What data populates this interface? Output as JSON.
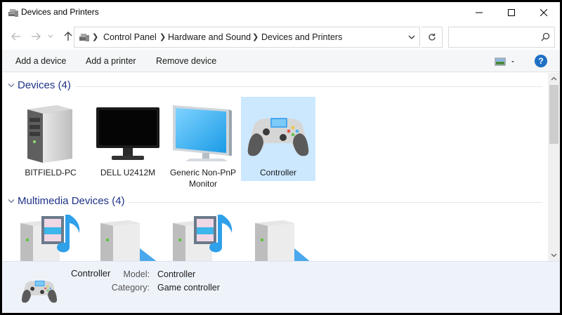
{
  "window": {
    "title": "Devices and Printers",
    "minimize_glyph": "—",
    "maximize_glyph": "☐",
    "close_glyph": "✕"
  },
  "address": {
    "crumbs": [
      "Control Panel",
      "Hardware and Sound",
      "Devices and Printers"
    ],
    "search_placeholder": ""
  },
  "toolbar": {
    "add_device": "Add a device",
    "add_printer": "Add a printer",
    "remove_device": "Remove device",
    "help": "?"
  },
  "groups": [
    {
      "title": "Devices (4)",
      "items": [
        {
          "label": "BITFIELD-PC",
          "icon": "desktop-computer-icon",
          "selected": false
        },
        {
          "label": "DELL U2412M",
          "icon": "monitor-icon",
          "selected": false
        },
        {
          "label": "Generic Non-PnP Monitor",
          "icon": "monitor-icon",
          "selected": false
        },
        {
          "label": "Controller",
          "icon": "game-controller-icon",
          "selected": true
        }
      ]
    },
    {
      "title": "Multimedia Devices (4)",
      "items": [
        {
          "label": "",
          "icon": "media-server-icon"
        },
        {
          "label": "",
          "icon": "media-device-icon"
        },
        {
          "label": "",
          "icon": "media-server-icon"
        },
        {
          "label": "",
          "icon": "media-device-icon"
        }
      ]
    }
  ],
  "details": {
    "name": "Controller",
    "fields": [
      {
        "key": "Model:",
        "value": "Controller"
      },
      {
        "key": "Category:",
        "value": "Game controller"
      }
    ]
  },
  "colors": {
    "accent": "#1e3287",
    "selection": "#cce8ff",
    "details_bg": "#eef3fa",
    "help": "#1f6fc4"
  }
}
